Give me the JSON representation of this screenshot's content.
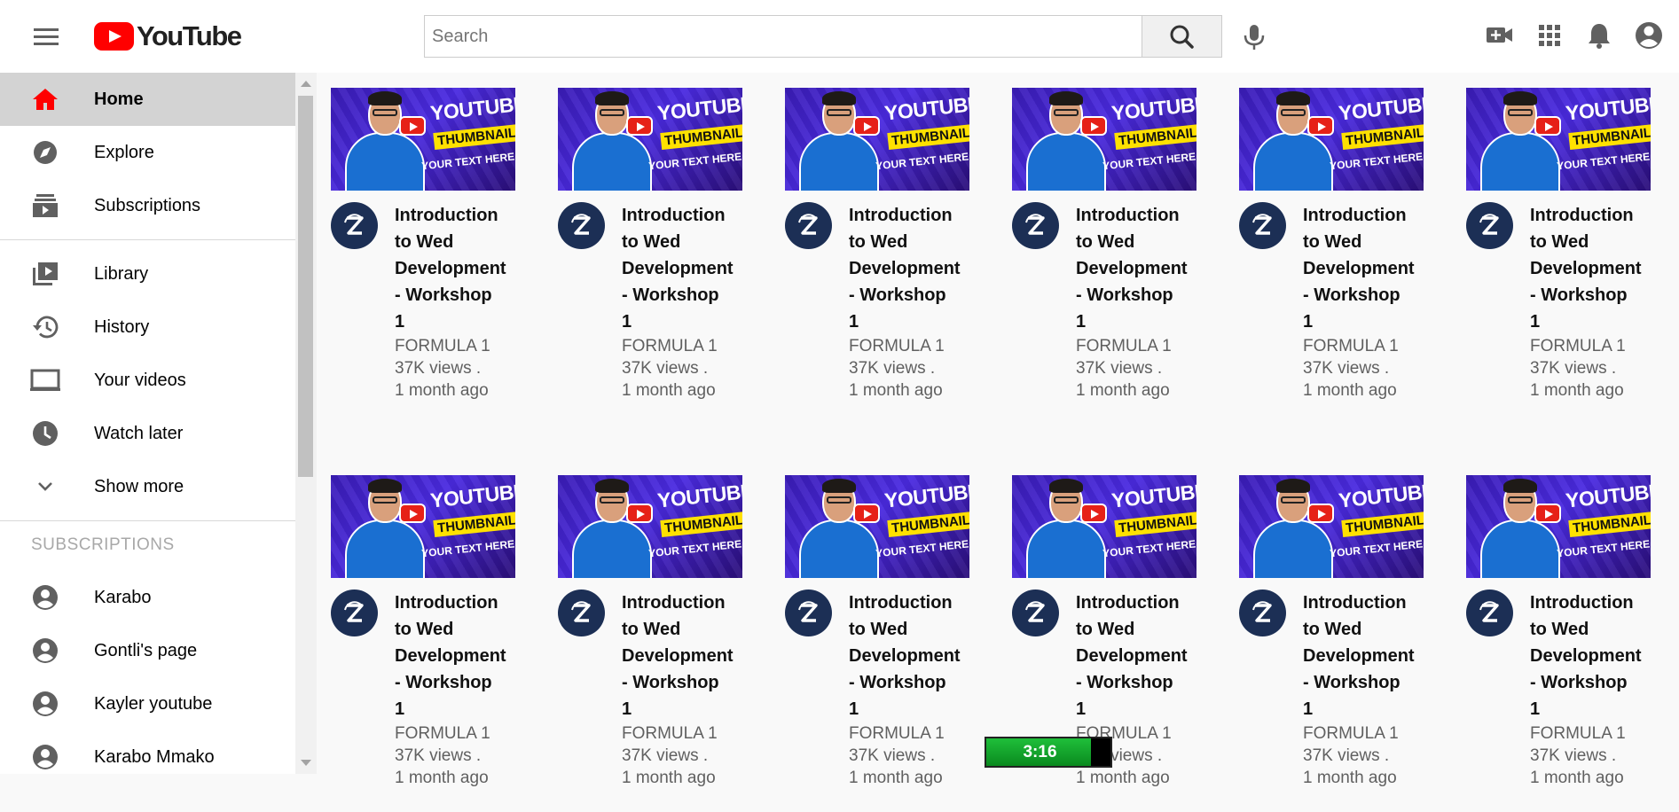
{
  "app": {
    "title": "YouTube",
    "brand_color": "#ff0000"
  },
  "header": {
    "logo_text": "YouTube",
    "search_placeholder": "Search",
    "icons": [
      "menu-icon",
      "search-icon",
      "mic-icon",
      "create-video-icon",
      "apps-icon",
      "notifications-icon",
      "account-icon"
    ]
  },
  "sidebar": {
    "main": [
      {
        "label": "Home",
        "icon": "home-icon",
        "active": true
      },
      {
        "label": "Explore",
        "icon": "compass-icon"
      },
      {
        "label": "Subscriptions",
        "icon": "subscriptions-icon"
      }
    ],
    "library": [
      {
        "label": "Library",
        "icon": "library-icon"
      },
      {
        "label": "History",
        "icon": "history-icon"
      },
      {
        "label": "Your videos",
        "icon": "your-videos-icon"
      },
      {
        "label": "Watch later",
        "icon": "clock-icon"
      },
      {
        "label": "Show more",
        "icon": "chevron-down-icon"
      }
    ],
    "subscriptions_title": "SUBSCRIPTIONS",
    "subscriptions": [
      {
        "label": "Karabo",
        "icon": "user-circle-icon"
      },
      {
        "label": "Gontli's page",
        "icon": "user-circle-icon"
      },
      {
        "label": "Kayler youtube",
        "icon": "user-circle-icon"
      },
      {
        "label": "Karabo Mmako",
        "icon": "user-circle-icon"
      }
    ]
  },
  "thumbnail_text": {
    "line1": "YOUTUBE",
    "line2": "THUMBNAIL",
    "line3": "YOUR TEXT HERE"
  },
  "videos": [
    {
      "title_lines": [
        "Introduction",
        "to Wed",
        "Development",
        "- Workshop",
        "1"
      ],
      "channel": "FORMULA 1",
      "views": "37K views .",
      "age": "1 month ago"
    },
    {
      "title_lines": [
        "Introduction",
        "to Wed",
        "Development",
        "- Workshop",
        "1"
      ],
      "channel": "FORMULA 1",
      "views": "37K views .",
      "age": "1 month ago"
    },
    {
      "title_lines": [
        "Introduction",
        "to Wed",
        "Development",
        "- Workshop",
        "1"
      ],
      "channel": "FORMULA 1",
      "views": "37K views .",
      "age": "1 month ago"
    },
    {
      "title_lines": [
        "Introduction",
        "to Wed",
        "Development",
        "- Workshop",
        "1"
      ],
      "channel": "FORMULA 1",
      "views": "37K views .",
      "age": "1 month ago"
    },
    {
      "title_lines": [
        "Introduction",
        "to Wed",
        "Development",
        "- Workshop",
        "1"
      ],
      "channel": "FORMULA 1",
      "views": "37K views .",
      "age": "1 month ago"
    },
    {
      "title_lines": [
        "Introduction",
        "to Wed",
        "Development",
        "- Workshop",
        "1"
      ],
      "channel": "FORMULA 1",
      "views": "37K views .",
      "age": "1 month ago"
    },
    {
      "title_lines": [
        "Introduction",
        "to Wed",
        "Development",
        "- Workshop",
        "1"
      ],
      "channel": "FORMULA 1",
      "views": "37K views .",
      "age": "1 month ago"
    },
    {
      "title_lines": [
        "Introduction",
        "to Wed",
        "Development",
        "- Workshop",
        "1"
      ],
      "channel": "FORMULA 1",
      "views": "37K views .",
      "age": "1 month ago"
    },
    {
      "title_lines": [
        "Introduction",
        "to Wed",
        "Development",
        "- Workshop",
        "1"
      ],
      "channel": "FORMULA 1",
      "views": "37K views .",
      "age": "1 month ago"
    },
    {
      "title_lines": [
        "Introduction",
        "to Wed",
        "Development",
        "- Workshop",
        "1"
      ],
      "channel": "FORMULA 1",
      "views": "37K views .",
      "age": "1 month ago"
    },
    {
      "title_lines": [
        "Introduction",
        "to Wed",
        "Development",
        "- Workshop",
        "1"
      ],
      "channel": "FORMULA 1",
      "views": "37K views .",
      "age": "1 month ago"
    },
    {
      "title_lines": [
        "Introduction",
        "to Wed",
        "Development",
        "- Workshop",
        "1"
      ],
      "channel": "FORMULA 1",
      "views": "37K views .",
      "age": "1 month ago"
    }
  ],
  "timer": {
    "text": "3:16",
    "progress": 0.84,
    "color": "#16a32e"
  }
}
